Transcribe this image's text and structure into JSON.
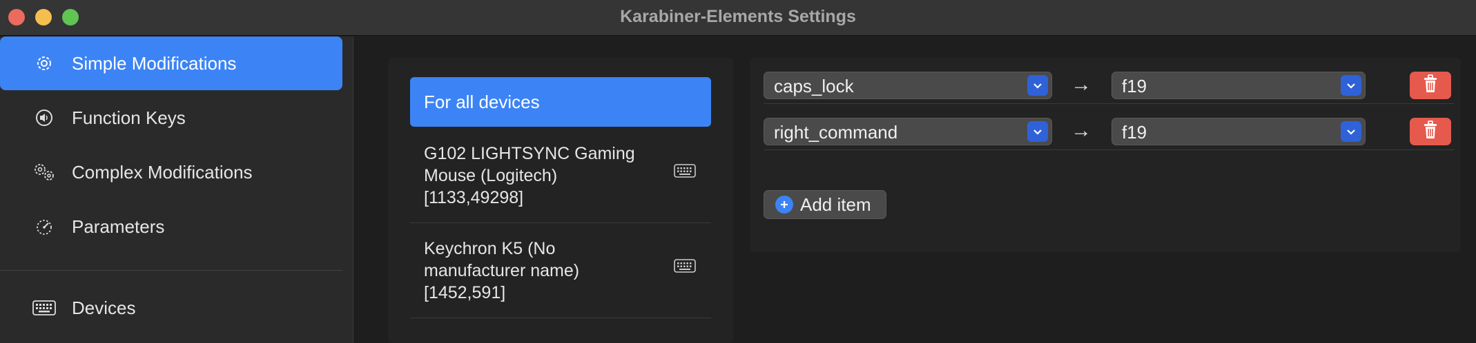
{
  "window": {
    "title": "Karabiner-Elements Settings"
  },
  "sidebar": {
    "items": [
      {
        "label": "Simple Modifications",
        "icon": "gear-icon",
        "active": true
      },
      {
        "label": "Function Keys",
        "icon": "speaker-icon",
        "active": false
      },
      {
        "label": "Complex Modifications",
        "icon": "gears-icon",
        "active": false
      },
      {
        "label": "Parameters",
        "icon": "gauge-icon",
        "active": false
      },
      {
        "label": "Devices",
        "icon": "keyboard-icon",
        "active": false
      }
    ]
  },
  "devices": {
    "selected": "For all devices",
    "items": [
      {
        "label": "G102 LIGHTSYNC Gaming Mouse (Logitech) [1133,49298]",
        "icon": "keyboard-icon"
      },
      {
        "label": "Keychron K5 (No manufacturer name) [1452,591]",
        "icon": "keyboard-icon"
      }
    ]
  },
  "mappings": [
    {
      "from": "caps_lock",
      "to": "f19"
    },
    {
      "from": "right_command",
      "to": "f19"
    }
  ],
  "arrow_glyph": "→",
  "add_item_label": "Add item",
  "colors": {
    "accent": "#3c84f5",
    "delete": "#e55a4d",
    "dropdown": "#2f62d8"
  }
}
